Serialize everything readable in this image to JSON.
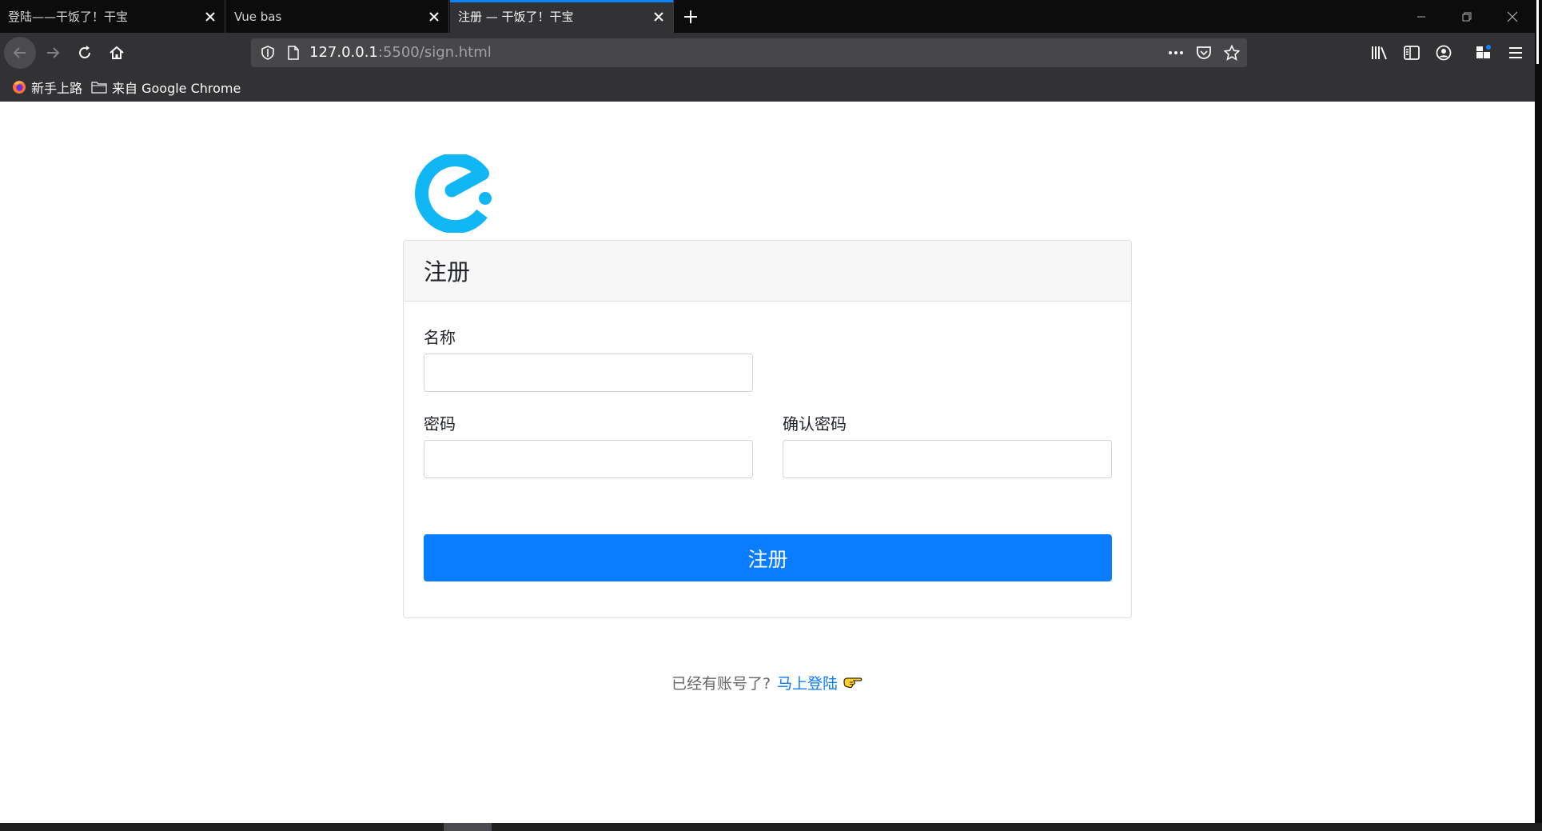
{
  "browser": {
    "tabs": [
      {
        "title": "登陆——干饭了！干宝",
        "active": false
      },
      {
        "title": "Vue bas",
        "active": false
      },
      {
        "title": "注册 — 干饭了！干宝",
        "active": true
      }
    ],
    "url": {
      "host": "127.0.0.1",
      "rest": ":5500/sign.html"
    },
    "bookmarks": [
      {
        "label": "新手上路",
        "icon": "firefox-icon"
      },
      {
        "label": "来自 Google Chrome",
        "icon": "folder-icon"
      }
    ],
    "accent": "#0a84ff"
  },
  "page": {
    "logo_color": "#11b6f5",
    "card_title": "注册",
    "fields": {
      "name_label": "名称",
      "password_label": "密码",
      "confirm_label": "确认密码",
      "name_value": "",
      "password_value": "",
      "confirm_value": ""
    },
    "submit_label": "注册",
    "primary_color": "#0a7cff",
    "footer": {
      "prompt": "已经有账号了?",
      "link": "马上登陆",
      "icon": "pointing-hand-icon"
    }
  }
}
